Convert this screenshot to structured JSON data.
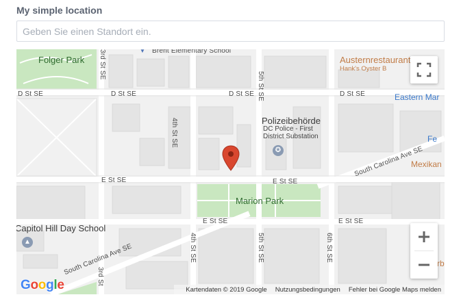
{
  "form": {
    "label": "My simple location",
    "input_placeholder": "Geben Sie einen Standort ein.",
    "input_value": ""
  },
  "map": {
    "pois": {
      "folger_park": "Folger Park",
      "brent_school": "Brent Elementary School",
      "austernrestaurant": "Austernrestaurant",
      "hanks_oyster": "Hank's Oyster B",
      "eastern_mark": "Eastern Mar",
      "polizei": "Polizeibehörde",
      "dc_police_1": "DC Police - First",
      "dc_police_2": "District Substation",
      "marion_park": "Marion Park",
      "capitol_hill": "Capitol Hill Day School",
      "mexikan": "Mexikan",
      "fe": "Fe",
      "rb": "rb"
    },
    "streets": {
      "d_st_1": "D St SE",
      "d_st_2": "D St SE",
      "d_st_3": "D St SE",
      "d_st_4": "D St SE",
      "e_st_1": "E St SE",
      "e_st_2": "E St SE",
      "e_st_3": "E St SE",
      "e_st_4": "E St SE",
      "fourth_st_1": "4th St SE",
      "fourth_st_2": "4th St SE",
      "fifth_st_1": "5th St SE",
      "fifth_st_2": "5th St SE",
      "sixth_st": "6th St SE",
      "third_st_1": "3rd St SE",
      "third_st_2": "3rd St",
      "sc_ave_1": "South Carolina Ave SE",
      "sc_ave_2": "South Carolina Ave SE"
    },
    "attribution": {
      "mapdata": "Kartendaten © 2019 Google",
      "terms": "Nutzungsbedingungen",
      "report": "Fehler bei Google Maps melden"
    },
    "logo": {
      "g1": "G",
      "o1": "o",
      "o2": "o",
      "g2": "g",
      "l": "l",
      "e": "e"
    },
    "colors": {
      "park": "#c9e7c0",
      "road": "#ffffff",
      "block": "#f1f1f1",
      "building": "#e4e4e4",
      "marker": "#d9472f"
    },
    "controls": {
      "fullscreen_icon": "fullscreen-icon",
      "zoom_in_icon": "zoom-in-icon",
      "zoom_out_icon": "zoom-out-icon"
    }
  }
}
